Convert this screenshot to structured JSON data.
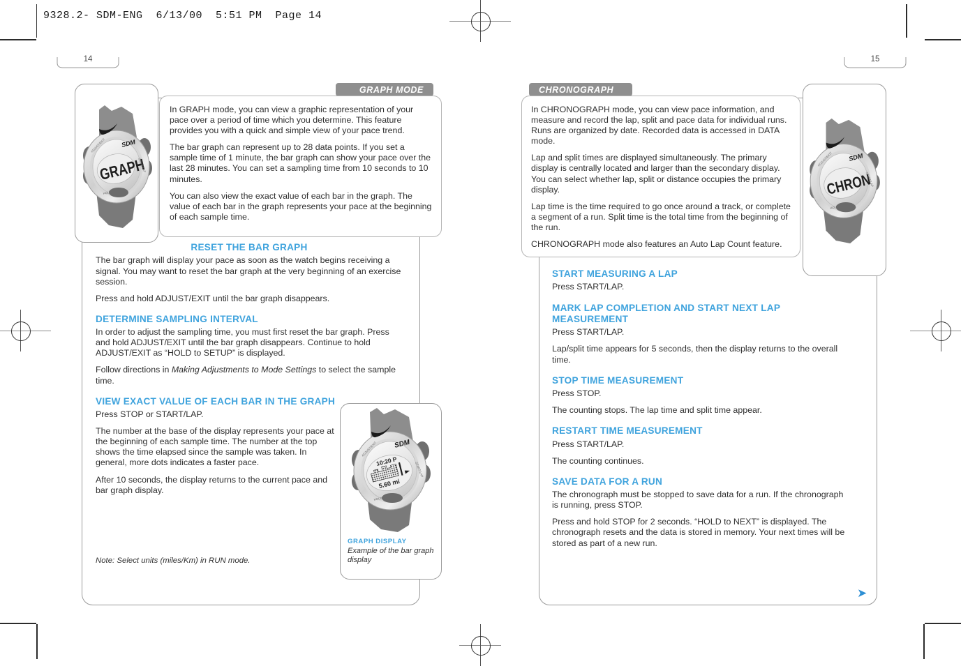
{
  "prepress": {
    "slug": "9328.2- SDM-ENG  6/13/00  5:51 PM  Page 14"
  },
  "left_page": {
    "page_number": "14",
    "banner": "GRAPH MODE",
    "intro_paragraphs": [
      "In GRAPH mode, you can view a graphic representation of your pace over a period of time which you determine. This feature provides you with a quick and simple view of your pace trend.",
      "The bar graph can represent up to 28 data points. If you set a sample time of 1 minute, the bar graph can show your pace over the last 28 minutes. You can set a sampling time from 10 seconds to 10 minutes.",
      "You can also view the exact value of each bar in the graph. The value of each bar in the graph represents your pace at the beginning of each sample time."
    ],
    "watch_top": {
      "brand": "SDM",
      "display_text": "GRAPH"
    },
    "sections": [
      {
        "heading": "RESET THE BAR GRAPH",
        "paragraphs": [
          "The bar graph will display your pace as soon as the watch begins receiving a signal. You may want to reset the bar graph at the very beginning of an exercise session.",
          "Press and hold ADJUST/EXIT until the bar graph disappears."
        ]
      },
      {
        "heading": "DETERMINE SAMPLING INTERVAL",
        "paragraphs": [
          "In order to adjust the sampling time, you must first reset the bar graph. Press and hold ADJUST/EXIT until the bar graph disappears. Continue to hold ADJUST/EXIT as “HOLD to SETUP” is displayed."
        ],
        "paragraph_with_italic": {
          "before": "Follow directions in ",
          "italic": "Making Adjustments to Mode Settings",
          "after": " to select the sample time."
        }
      },
      {
        "heading": "VIEW EXACT VALUE OF EACH BAR IN THE GRAPH",
        "paragraphs": [
          "Press STOP or START/LAP.",
          "The number at the base of the display represents your pace at the beginning of each sample time. The number at the top shows the time elapsed since the sample was taken. In general, more dots indicates a faster pace.",
          "After 10 seconds, the display returns to the current pace and bar graph display."
        ]
      }
    ],
    "note": "Note: Select units (miles/Km) in RUN mode.",
    "figure": {
      "caption_title": "GRAPH DISPLAY",
      "caption_text": "Example of the bar graph display",
      "watch": {
        "brand": "SDM",
        "top_value": "10:20 P",
        "bottom_value": "5.60 mi"
      }
    }
  },
  "right_page": {
    "page_number": "15",
    "banner": "CHRONOGRAPH",
    "intro_paragraphs": [
      "In CHRONOGRAPH mode, you can view pace information, and measure and record the lap, split and pace data for individual runs. Runs are organized by date. Recorded data is accessed in DATA mode.",
      "Lap and split times are displayed simultaneously. The primary display is centrally located and larger than the secondary display. You can select whether lap, split or distance occupies the primary display.",
      "Lap time is the time required to go once around a track, or complete a segment of a run. Split time is the total time from the beginning of the run.",
      "CHRONOGRAPH mode also features an Auto Lap Count feature."
    ],
    "watch_top": {
      "brand": "SDM",
      "display_text": "CHRON"
    },
    "sections": [
      {
        "heading": "START MEASURING A LAP",
        "paragraphs": [
          "Press START/LAP."
        ]
      },
      {
        "heading": "MARK LAP COMPLETION AND START NEXT LAP MEASUREMENT",
        "paragraphs": [
          "Press START/LAP.",
          "Lap/split time appears for 5 seconds, then the display returns to the overall time."
        ]
      },
      {
        "heading": "STOP TIME MEASUREMENT",
        "paragraphs": [
          "Press STOP.",
          "The counting stops. The lap time and split time appear."
        ]
      },
      {
        "heading": "RESTART TIME MEASUREMENT",
        "paragraphs": [
          "Press START/LAP.",
          "The counting continues."
        ]
      },
      {
        "heading": "SAVE DATA FOR A RUN",
        "paragraphs": [
          "The chronograph must be stopped to save data for a run. If the chronograph is running, press STOP.",
          "Press and hold STOP for 2 seconds. “HOLD to NEXT” is displayed. The chronograph resets and the data is stored in memory. Your next times will be stored as part of a new run."
        ]
      }
    ],
    "continue_arrow": "➤"
  },
  "colors": {
    "heading_blue": "#3fa3dd",
    "banner_gray": "#8f8f8f",
    "body_text": "#2f2f2f",
    "frame_border": "#9a9a9a"
  }
}
